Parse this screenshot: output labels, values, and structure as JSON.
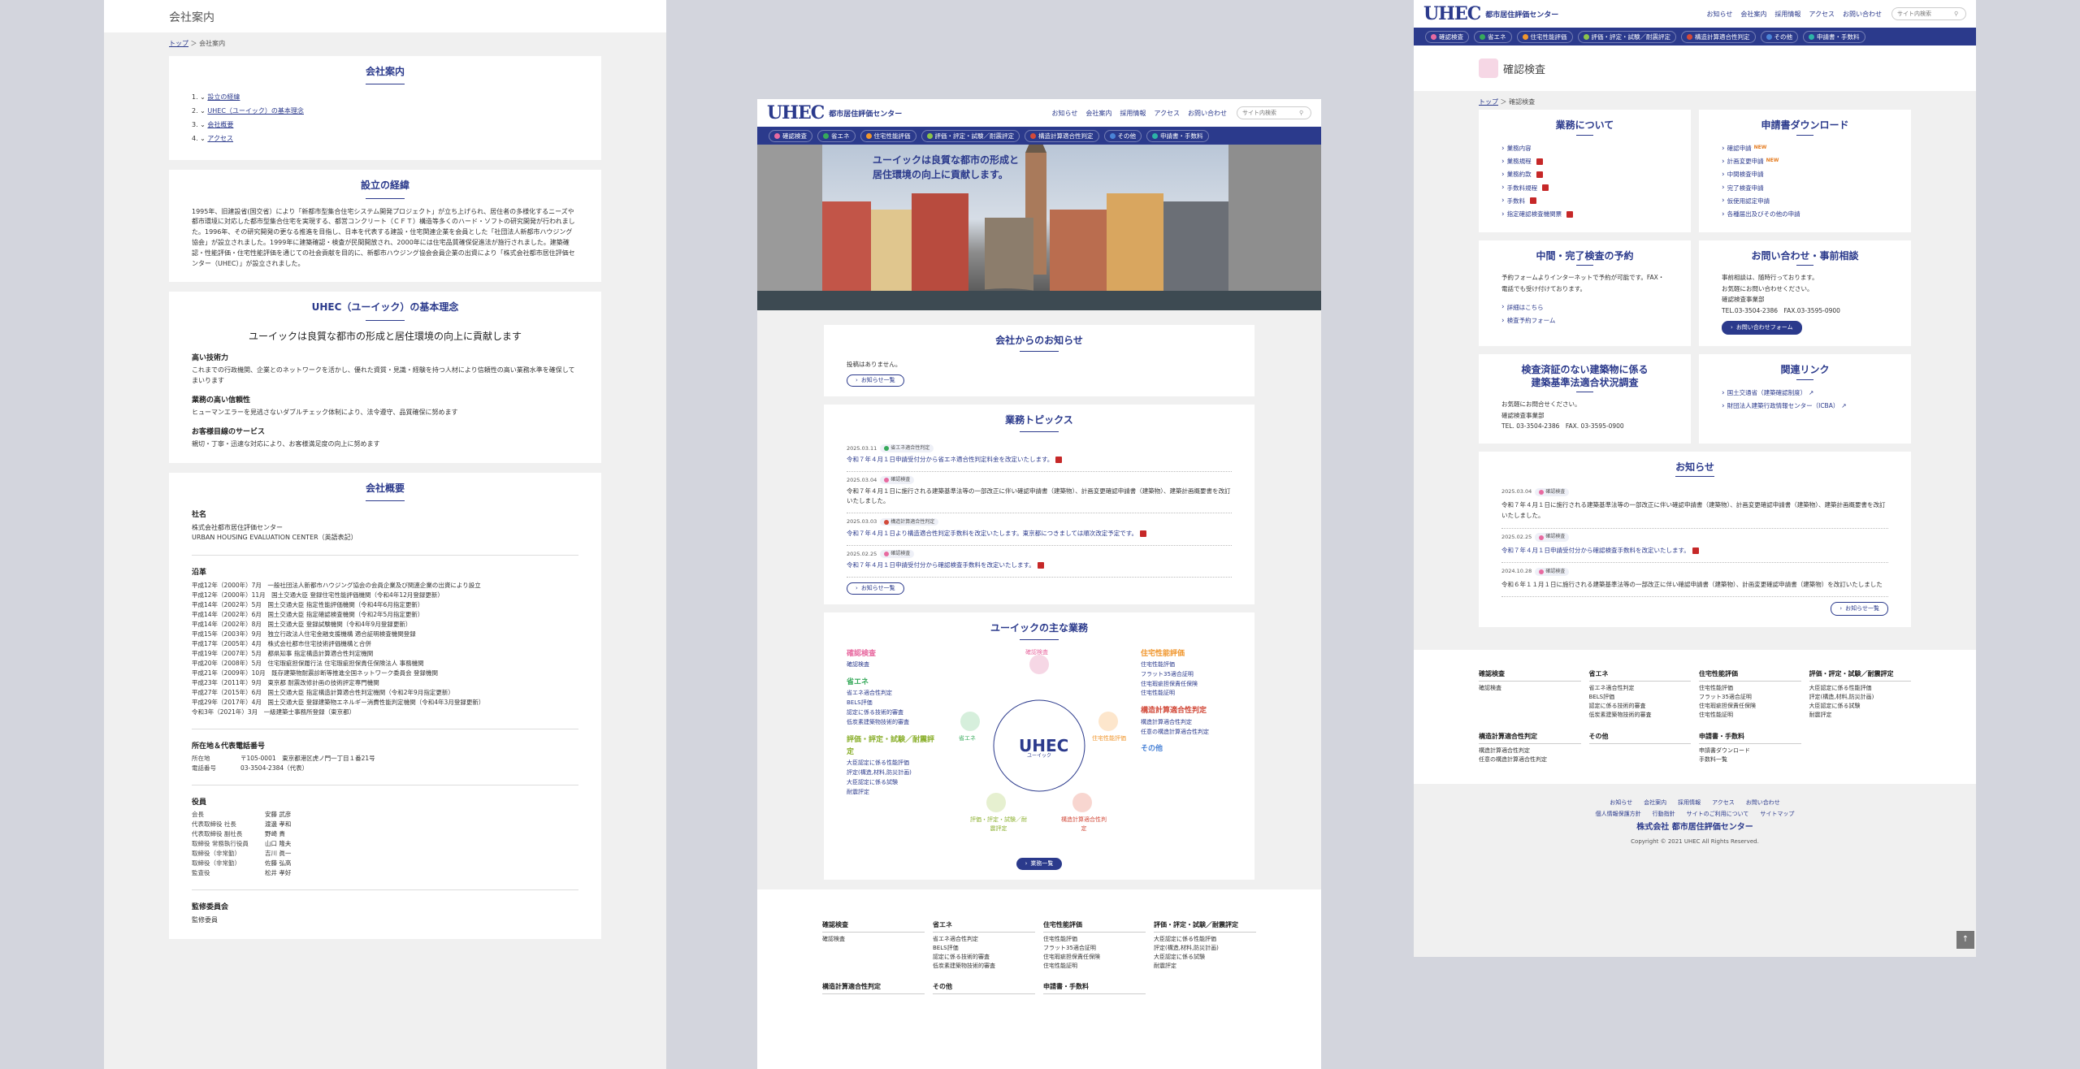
{
  "colors": {
    "brand": "#2b3a8c",
    "tag_pink": "#e86aa0",
    "tag_green": "#36a95a",
    "tag_orange": "#f0962d",
    "tag_purple": "#8e5cc9",
    "tag_red": "#d24a3a",
    "tag_blue": "#4a83d6",
    "tag_teal": "#2db3a6"
  },
  "p1": {
    "header": "会社案内",
    "crumb_top": "トップ",
    "crumb_current": "会社案内",
    "toc_title": "会社案内",
    "toc": [
      "設立の経緯",
      "UHEC（ユーイック）の基本理念",
      "会社概要",
      "アクセス"
    ],
    "history_title": "設立の経緯",
    "history_text": "1995年、旧建設省(国交省）により「新都市型集合住宅システム開発プロジェクト」が立ち上げられ、居住者の多様化するニーズや都市環境に対応した都市型集合住宅を実現する、都営コンクリート（ＣＦＴ）構造等多くのハード・ソフトの研究開発が行われました。1996年、その研究開発の更なる推進を目指し、日本を代表する建設・住宅関連企業を会員とした「社団法人新都市ハウジング協会」が設立されました。1999年に建築確認・検査が民間開放され、2000年には住宅品質確保促進法が施行されました。建築確認・性能評価・住宅性能評価を通じての社会貢献を目的に、新都市ハウジング協会会員企業の出資により「株式会社都市居住評価センター（UHEC）」が設立されました。",
    "philosophy_title": "UHEC（ユーイック）の基本理念",
    "philosophy_lead": "ユーイックは良質な都市の形成と居住環境の向上に貢献します",
    "philosophy": [
      {
        "h": "高い技術力",
        "t": "これまでの行政機関、企業とのネットワークを活かし、優れた資質・見識・経験を持つ人材により信頼性の高い業務水準を確保してまいります"
      },
      {
        "h": "業務の高い信頼性",
        "t": "ヒューマンエラーを見逃さないダブルチェック体制により、法令遵守、品質確保に努めます"
      },
      {
        "h": "お客様目線のサービス",
        "t": "親切・丁寧・迅速な対応により、お客様満足度の向上に努めます"
      }
    ],
    "overview_title": "会社概要",
    "name_label": "社名",
    "name_jp": "株式会社都市居住評価センター",
    "name_en": "URBAN HOUSING EVALUATION CENTER（英語表記）",
    "history_label": "沿革",
    "history_rows": [
      "平成12年（2000年）7月　一般社団法人新都市ハウジング協会の会員企業及び関連企業の出資により設立",
      "平成12年（2000年）11月　国土交通大臣 登録住宅性能評価機関（令和4年12月登録更新）",
      "平成14年（2002年）5月　国土交通大臣 指定性能評価機関（令和4年6月指定更新）",
      "平成14年（2002年）6月　国土交通大臣 指定確認検査機関（令和2年5月指定更新）",
      "平成14年（2002年）8月　国土交通大臣 登録試験機関（令和4年9月登録更新）",
      "平成15年（2003年）9月　独立行政法人住宅金融支援機構 適合証明検査機関登録",
      "平成17年（2005年）4月　株式会社都市住宅技術評価機構と合併",
      "平成19年（2007年）5月　都県知事 指定構造計算適合性判定機関",
      "平成20年（2008年）5月　住宅瑕疵担保履行法 住宅瑕疵担保責任保険法人 事務機関",
      "平成21年（2009年）10月　既存建築物耐震診断等推進全国ネットワーク委員会 登録機関",
      "平成23年（2011年）9月　東京都 耐震改修計画の技術評定専門機関",
      "平成27年（2015年）6月　国土交通大臣 指定構造計算適合性判定機関（令和2年9月指定更新）",
      "平成29年（2017年）4月　国土交通大臣 登録建築物エネルギー消費性能判定機関（令和4年3月登録更新）",
      "令和3年（2021年）3月　一級建築士事務所登録（東京都）"
    ],
    "addr_label": "所在地＆代表電話番号",
    "addr": [
      {
        "k": "所在地",
        "v": "〒105-0001　東京都港区虎ノ門一丁目１番21号"
      },
      {
        "k": "電話番号",
        "v": "03-3504-2384（代表）"
      }
    ],
    "officers_label": "役員",
    "officers": [
      {
        "k": "会長",
        "v": "安藤 武彦"
      },
      {
        "k": "代表取締役 社長",
        "v": "渡邊 孝和"
      },
      {
        "k": "代表取締役 副社長",
        "v": "野崎 貴"
      },
      {
        "k": "取締役 常務執行役員",
        "v": "山口 隆夫"
      },
      {
        "k": "取締役（非常勤）",
        "v": "吉川 眞一"
      },
      {
        "k": "取締役（非常勤）",
        "v": "佐藤 弘高"
      },
      {
        "k": "監査役",
        "v": "松井 孝好"
      }
    ],
    "committee_label": "監修委員会",
    "committee_sub": "監修委員"
  },
  "header": {
    "logo": "UHEC",
    "logo_sub": "都市居住評価センター",
    "nav": [
      "お知らせ",
      "会社案内",
      "採用情報",
      "アクセス",
      "お問い合わせ"
    ],
    "search_placeholder": "サイト内検索"
  },
  "gnav": [
    "確認検査",
    "省エネ",
    "住宅性能評価",
    "評価・評定・試験／耐震評定",
    "構造計算適合性判定",
    "その他",
    "申請書・手数料"
  ],
  "p2": {
    "hero_line1": "ユーイックは良質な都市の形成と",
    "hero_line2": "居住環境の向上に貢献します。",
    "notice_title": "会社からのお知らせ",
    "notice_empty": "投稿はありません。",
    "notice_btn": "お知らせ一覧",
    "topics_title": "業務トピックス",
    "topics": [
      {
        "date": "2025.03.11",
        "tag": "省エネ適合性判定",
        "text": "令和７年４月１日申請受付分から省エネ適合性判定料金を改定いたします。",
        "link": true
      },
      {
        "date": "2025.03.04",
        "tag": "確認検査",
        "text": "令和７年４月１日に施行される建築基準法等の一部改正に伴い確認申請書（建築物）、計画変更確認申請書（建築物）、建築計画概要書を改訂いたしました。",
        "link": false
      },
      {
        "date": "2025.03.03",
        "tag": "構造計算適合性判定",
        "text": "令和７年４月１日より構造適合性判定手数料を改定いたします。東京都につきましては順次改定予定です。",
        "link": true
      },
      {
        "date": "2025.02.25",
        "tag": "確認検査",
        "text": "令和７年４月１日申請受付分から確認検査手数料を改定いたします。",
        "link": true
      }
    ],
    "topics_btn": "お知らせ一覧",
    "biz_title": "ユーイックの主な業務",
    "biz_left": [
      {
        "h": "確認検査",
        "items": [
          "確認検査"
        ]
      },
      {
        "h": "省エネ",
        "items": [
          "省エネ適合性判定",
          "BELS評価",
          "認定に係る技術的審査",
          "低炭素建築物技術的審査"
        ]
      },
      {
        "h": "評価・評定・試験／耐震評定",
        "items": [
          "大臣認定に係る性能評価",
          "評定(構造,材料,防災計画)",
          "大臣認定に係る試験",
          "耐震評定"
        ]
      }
    ],
    "biz_right": [
      {
        "h": "住宅性能評価",
        "items": [
          "住宅性能評価",
          "フラット35適合証明",
          "住宅瑕疵担保責任保険",
          "住宅性能証明"
        ]
      },
      {
        "h": "構造計算適合性判定",
        "items": [
          "構造計算適合性判定",
          "任意の構造計算適合性判定"
        ]
      },
      {
        "h": "その他",
        "items": []
      }
    ],
    "circle": {
      "top": "確認検査",
      "left": "省エネ",
      "right": "住宅性能評価",
      "bl": "評価・評定・試験／耐震評定",
      "br": "構造計算適合性判定",
      "center": "UHEC",
      "center_sub": "ユーイック"
    },
    "biz_btn": "業務一覧"
  },
  "footer": [
    {
      "h": "確認検査",
      "items": [
        "確認検査"
      ]
    },
    {
      "h": "省エネ",
      "items": [
        "省エネ適合性判定",
        "BELS評価",
        "認定に係る技術的審査",
        "低炭素建築物技術的審査"
      ]
    },
    {
      "h": "住宅性能評価",
      "items": [
        "住宅性能評価",
        "フラット35適合証明",
        "住宅瑕疵担保責任保険",
        "住宅性能証明"
      ]
    },
    {
      "h": "評価・評定・試験／耐震評定",
      "items": [
        "大臣認定に係る性能評価",
        "評定(構造,材料,防災計画)",
        "大臣認定に係る試験",
        "耐震評定"
      ]
    },
    {
      "h": "構造計算適合性判定",
      "items": [
        "構造計算適合性判定",
        "任意の構造計算適合性判定"
      ]
    },
    {
      "h": "その他",
      "items": []
    },
    {
      "h": "申請書・手数料",
      "items": [
        "申請書ダウンロード",
        "手数料一覧"
      ]
    }
  ],
  "p3": {
    "title": "確認検査",
    "crumb_top": "トップ",
    "crumb_current": "確認検査",
    "about_title": "業務について",
    "about": [
      "業務内容",
      "業務規程",
      "業務約款",
      "手数料規程",
      "手数料",
      "指定確認検査機関票"
    ],
    "dl_title": "申請書ダウンロード",
    "dl": [
      {
        "t": "確認申請",
        "new": "NEW"
      },
      {
        "t": "計画変更申請",
        "new": "NEW"
      },
      {
        "t": "中間検査申請",
        "new": ""
      },
      {
        "t": "完了検査申請",
        "new": ""
      },
      {
        "t": "仮使用認定申請",
        "new": ""
      },
      {
        "t": "各種届出及びその他の申請",
        "new": ""
      }
    ],
    "reserve_title": "中間・完了検査の予約",
    "reserve_text": "予約フォームよりインターネットで予約が可能です。FAX・電話でも受け付けております。",
    "reserve_links": [
      "詳細はこちら",
      "検査予約フォーム"
    ],
    "contact_title": "お問い合わせ・事前相談",
    "contact_lines": [
      "事前相談は、随時行っております。",
      "お気軽にお問い合わせください。",
      "確認検査事業部",
      "TEL.03-3504-2386　FAX.03-3595-0900"
    ],
    "contact_btn": "お問い合わせフォーム",
    "survey_title1": "検査済証のない建築物に係る",
    "survey_title2": "建築基準法適合状況調査",
    "survey_lines": [
      "お気軽にお問合せください。",
      "確認検査事業部",
      "TEL. 03-3504-2386　FAX. 03-3595-0900"
    ],
    "related_title": "関連リンク",
    "related": [
      "国土交通省（建築確認制度）",
      "財団法人建築行政情報センター（ICBA）"
    ],
    "news_title": "お知らせ",
    "news": [
      {
        "date": "2025.03.04",
        "tag": "確認検査",
        "text": "令和７年４月１日に施行される建築基準法等の一部改正に伴い確認申請書（建築物）、計画変更確認申請書（建築物）、建築計画概要書を改訂いたしました。"
      },
      {
        "date": "2025.02.25",
        "tag": "確認検査",
        "text": "令和７年４月１日申請受付分から確認検査手数料を改定いたします。"
      },
      {
        "date": "2024.10.28",
        "tag": "確認検査",
        "text": "令和６年１１月１日に施行される建築基準法等の一部改正に伴い確認申請書（建築物）、計画変更確認申請書（建築物）を改訂いたしました"
      }
    ],
    "news_btn": "お知らせ一覧",
    "bottom_links": [
      "お知らせ",
      "会社案内",
      "採用情報",
      "アクセス",
      "お問い合わせ"
    ],
    "bottom_links2": [
      "個人情報保護方針",
      "行動指針",
      "サイトのご利用について",
      "サイトマップ"
    ],
    "company": "株式会社 都市居住評価センター",
    "copyright": "Copyright © 2021 UHEC All Rights Reserved."
  }
}
